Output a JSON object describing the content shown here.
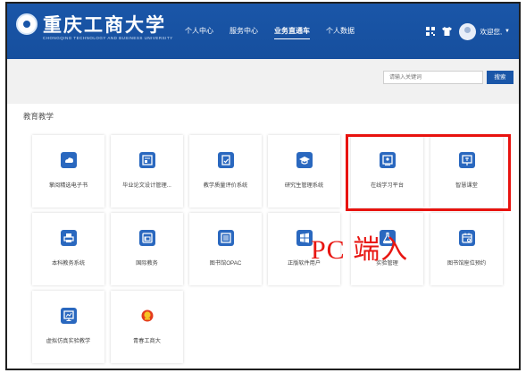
{
  "header": {
    "logo_title": "重庆工商大学",
    "logo_subtitle": "CHONGQING TECHNOLOGY AND BUSINESS UNIVERSITY",
    "nav": [
      {
        "label": "个人中心",
        "active": false
      },
      {
        "label": "服务中心",
        "active": false
      },
      {
        "label": "业务直通车",
        "active": true
      },
      {
        "label": "个人数据",
        "active": false
      }
    ],
    "welcome": "欢迎您,",
    "qr_icon": "qr-code-icon",
    "shirt_icon": "shirt-icon"
  },
  "search": {
    "placeholder": "请输入关键词",
    "button": "搜索"
  },
  "section": {
    "title": "教育教学"
  },
  "tiles": [
    {
      "label": "掌阅精选电子书",
      "icon": "cloud-book-icon"
    },
    {
      "label": "毕业论文设计管理...",
      "icon": "thesis-icon"
    },
    {
      "label": "教学质量评价系统",
      "icon": "evaluation-icon"
    },
    {
      "label": "研究生管理系统",
      "icon": "graduate-cap-icon"
    },
    {
      "label": "在线学习平台",
      "icon": "online-learning-icon"
    },
    {
      "label": "智慧课堂",
      "icon": "smart-classroom-icon"
    },
    {
      "label": "本科教务系统",
      "icon": "printer-icon"
    },
    {
      "label": "国际教务",
      "icon": "international-icon"
    },
    {
      "label": "图书馆OPAC",
      "icon": "library-catalog-icon"
    },
    {
      "label": "正版软件用户",
      "icon": "windows-icon"
    },
    {
      "label": "实验管理",
      "icon": "flask-icon"
    },
    {
      "label": "图书馆座位预约",
      "icon": "seat-booking-icon"
    },
    {
      "label": "虚拟仿真实验教学",
      "icon": "virtual-lab-icon"
    },
    {
      "label": "青春工商大",
      "icon": "youth-league-icon"
    }
  ],
  "annotation": {
    "text": "PC 端入",
    "color": "#e81612"
  },
  "colors": {
    "header_blue": "#1a56a8",
    "tile_icon_blue": "#2a68bf",
    "highlight_red": "#e8130f"
  }
}
